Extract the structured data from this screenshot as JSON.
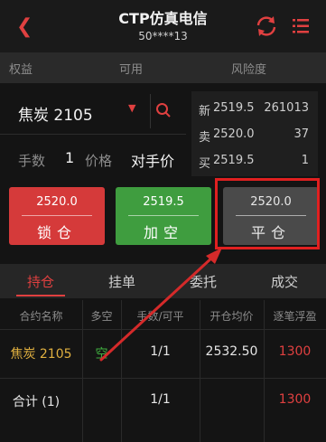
{
  "header": {
    "title": "CTP仿真电信",
    "account": "50****13"
  },
  "account_bar": {
    "equity_label": "权益",
    "available_label": "可用",
    "risk_label": "风险度"
  },
  "order_panel": {
    "contract": "焦炭 2105",
    "qty_label": "手数",
    "qty_value": "1",
    "price_label": "价格",
    "price_value": "对手价"
  },
  "quote": {
    "rows": [
      {
        "label": "新",
        "price": "2519.5",
        "volume": "261013"
      },
      {
        "label": "卖",
        "price": "2520.0",
        "volume": "37"
      },
      {
        "label": "买",
        "price": "2519.5",
        "volume": "1"
      }
    ]
  },
  "buttons": {
    "lock": {
      "price": "2520.0",
      "label": "锁仓"
    },
    "short": {
      "price": "2519.5",
      "label": "加空"
    },
    "close": {
      "price": "2520.0",
      "label": "平仓"
    }
  },
  "tabs": [
    "持仓",
    "挂单",
    "委托",
    "成交"
  ],
  "table": {
    "headers": [
      "合约名称",
      "多空",
      "手数/可平",
      "开仓均价",
      "逐笔浮盈"
    ],
    "rows": [
      {
        "name": "焦炭 2105",
        "direction": "空",
        "qty": "1/1",
        "avg_price": "2532.50",
        "pnl": "1300"
      },
      {
        "name": "合计 (1)",
        "direction": "",
        "qty": "1/1",
        "avg_price": "",
        "pnl": "1300"
      }
    ]
  },
  "colors": {
    "accent_red": "#e04040",
    "buy_red": "#d53a3a",
    "sell_green": "#3f9d3f",
    "close_gray": "#4a4a4a",
    "annotation_red": "#e02020"
  }
}
